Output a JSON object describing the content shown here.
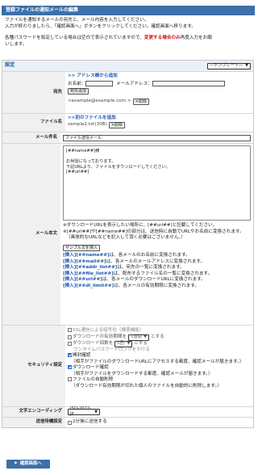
{
  "page": {
    "title": "登録ファイルの通知メールの編集",
    "intro_line1": "ファイルを通知するメールの宛先と、メール内容を入力してください。",
    "intro_line2": "入力が終わりましたら、「確認画面へ」ボタンをクリックしてください。確認画面へ移ります。",
    "intro_line3_pre": "各種パスワードを設定している場合は空白で表示されていますので、",
    "intro_line3_red": "変更する場合のみ",
    "intro_line3_post": "再度入力をお願",
    "intro_line4": "いします。"
  },
  "settings": {
    "title": "設定",
    "template_select": "―テンプレート―"
  },
  "recipient": {
    "label": "宛先",
    "add_from_address_book": ">> アドレス帳から追加",
    "name_label": "お名前：",
    "email_label": "メールアドレス：",
    "add_button": "宛先追加",
    "existing": "<example@example.com >",
    "delete_button": "削除"
  },
  "file_name": {
    "label": "ファイル名",
    "add_other_file": ">>別のファイルを追加",
    "file": "sample2.txt(30B)",
    "delete_button": "削除"
  },
  "subject": {
    "label": "メール件名",
    "value": "ファイル送信メール"
  },
  "body": {
    "label": "メール本文",
    "textarea_lines": [
      "[##name##]様",
      "",
      "お世話になっております。",
      "下記URLより、ファイルをダウンロードしてください。",
      "[##url##]"
    ],
    "note1": "※ダウンロードURLを表示したい場所に、[##url##]と記載してください。",
    "note2": "※[##url##]や[##name##]の部分は、送信時に自動でURLやお名前に変換されます。",
    "note3": "（具体的なURLなどを記入して頂く必要はございません。）",
    "sample_button": "サンプル文を挿入",
    "inserts": [
      {
        "tag": "[挿入]",
        "code": "[##name##]",
        "desc": "は、各メールのお名前に変換されます。"
      },
      {
        "tag": "[挿入]",
        "code": "[##mail##]",
        "desc": "は、各メールのメールアドレスに変換されます。"
      },
      {
        "tag": "[挿入]",
        "code": "[##addr_list##]",
        "desc": "は、宛先の一覧に変換されます。"
      },
      {
        "tag": "[挿入]",
        "code": "[##file_list##]",
        "desc": "は、配布するファイル名の一覧に変換されます。"
      },
      {
        "tag": "[挿入]",
        "code": "[##url##]",
        "desc": "は、各メールのダウンロードURLに変換されます。"
      },
      {
        "tag": "[挿入]",
        "code": "[##dl_limit##]",
        "desc": "は、各メールの有効期限に変換されます。"
      }
    ]
  },
  "security": {
    "label": "セキュリティ設定",
    "ssl": "SSL通信による暗号化（標準機能）",
    "period_pre": "ダウンロードの有効期間を",
    "period_value": "1週間",
    "period_post": "とする",
    "count_pre": "ダウンロード回数を",
    "count_value": "5回",
    "count_post": "とする",
    "onetime": "ワンタイムパスワードロックをかける",
    "open_confirm": "開封確認",
    "open_confirm_note": "（相手がファイルのダウンロードURLにアクセスする都度、確認メールが届きます。）",
    "dl_confirm": "ダウンロード確認",
    "dl_confirm_note": "（相手がファイルをダウンロードする都度、確認メールが届きます。）",
    "auto_delete": "ファイルの自動削除",
    "auto_delete_note": "（ダウンロード有効期限が切れた個人のファイルを自動的に削除します。）"
  },
  "encoding": {
    "label": "文字エンコーディング",
    "value": "ISO-2022-JP"
  },
  "send_setting": {
    "label": "送信待機設定",
    "option": "2分後に送信する"
  },
  "confirm_button": "確認画面へ"
}
